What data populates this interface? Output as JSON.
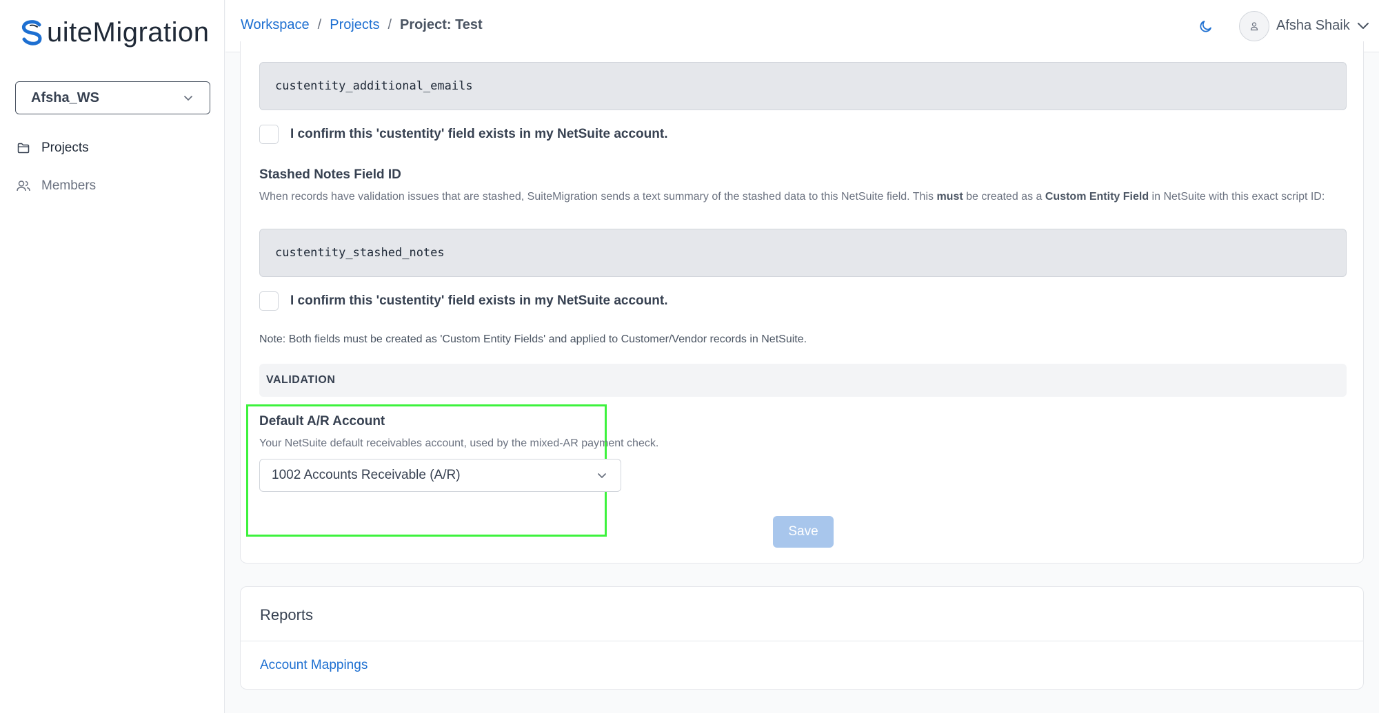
{
  "brand": {
    "name_rest": "uiteMigration",
    "name_initial": "S",
    "accent": "#1d6fd1"
  },
  "sidebar": {
    "workspace": "Afsha_WS",
    "items": [
      {
        "label": "Projects",
        "icon": "folder-icon"
      },
      {
        "label": "Members",
        "icon": "users-icon"
      }
    ]
  },
  "header": {
    "breadcrumb": [
      "Workspace",
      "Projects",
      "Project: Test"
    ],
    "separator": "/",
    "user_name": "Afsha Shaik"
  },
  "settings": {
    "additional_emails_field": "custentity_additional_emails",
    "confirm_label": "I confirm this 'custentity' field exists in my NetSuite account.",
    "stashed_title": "Stashed Notes Field ID",
    "stashed_desc_1": "When records have validation issues that are stashed, SuiteMigration sends a text summary of the stashed data to this NetSuite field. This ",
    "stashed_desc_must": "must",
    "stashed_desc_2": " be created as a ",
    "stashed_desc_cef": "Custom Entity Field",
    "stashed_desc_3": " in NetSuite with this exact script ID:",
    "stashed_field": "custentity_stashed_notes",
    "note": "Note: Both fields must be created as 'Custom Entity Fields' and applied to Customer/Vendor records in NetSuite.",
    "section_validation": "VALIDATION",
    "ar_title": "Default A/R Account",
    "ar_desc": "Your NetSuite default receivables account, used by the mixed-AR payment check.",
    "ar_selected": "1002 Accounts Receivable (A/R)",
    "save_label": "Save"
  },
  "reports": {
    "title": "Reports",
    "link": "Account Mappings"
  }
}
